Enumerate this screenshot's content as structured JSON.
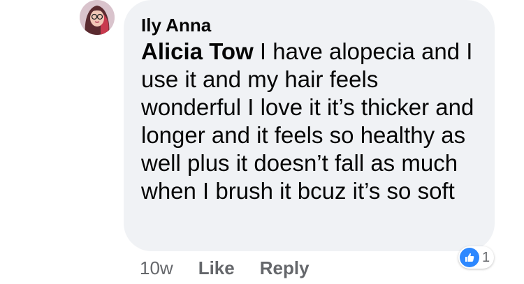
{
  "comment": {
    "author": "Ily Anna",
    "mention": "Alicia Tow",
    "text": " I have alopecia and I use it and my hair feels wonderful I love it it’s thicker and longer and it feels so healthy as well plus it doesn’t fall as much when I brush it bcuz it’s so soft",
    "timestamp": "10w",
    "like_label": "Like",
    "reply_label": "Reply",
    "reaction_count": "1"
  },
  "colors": {
    "bubble_bg": "#f0f2f5",
    "text": "#050505",
    "secondary_text": "#65676b",
    "like_blue": "#2d88ff"
  },
  "icons": {
    "avatar": "avatar",
    "reaction": "thumbs-up-icon"
  }
}
